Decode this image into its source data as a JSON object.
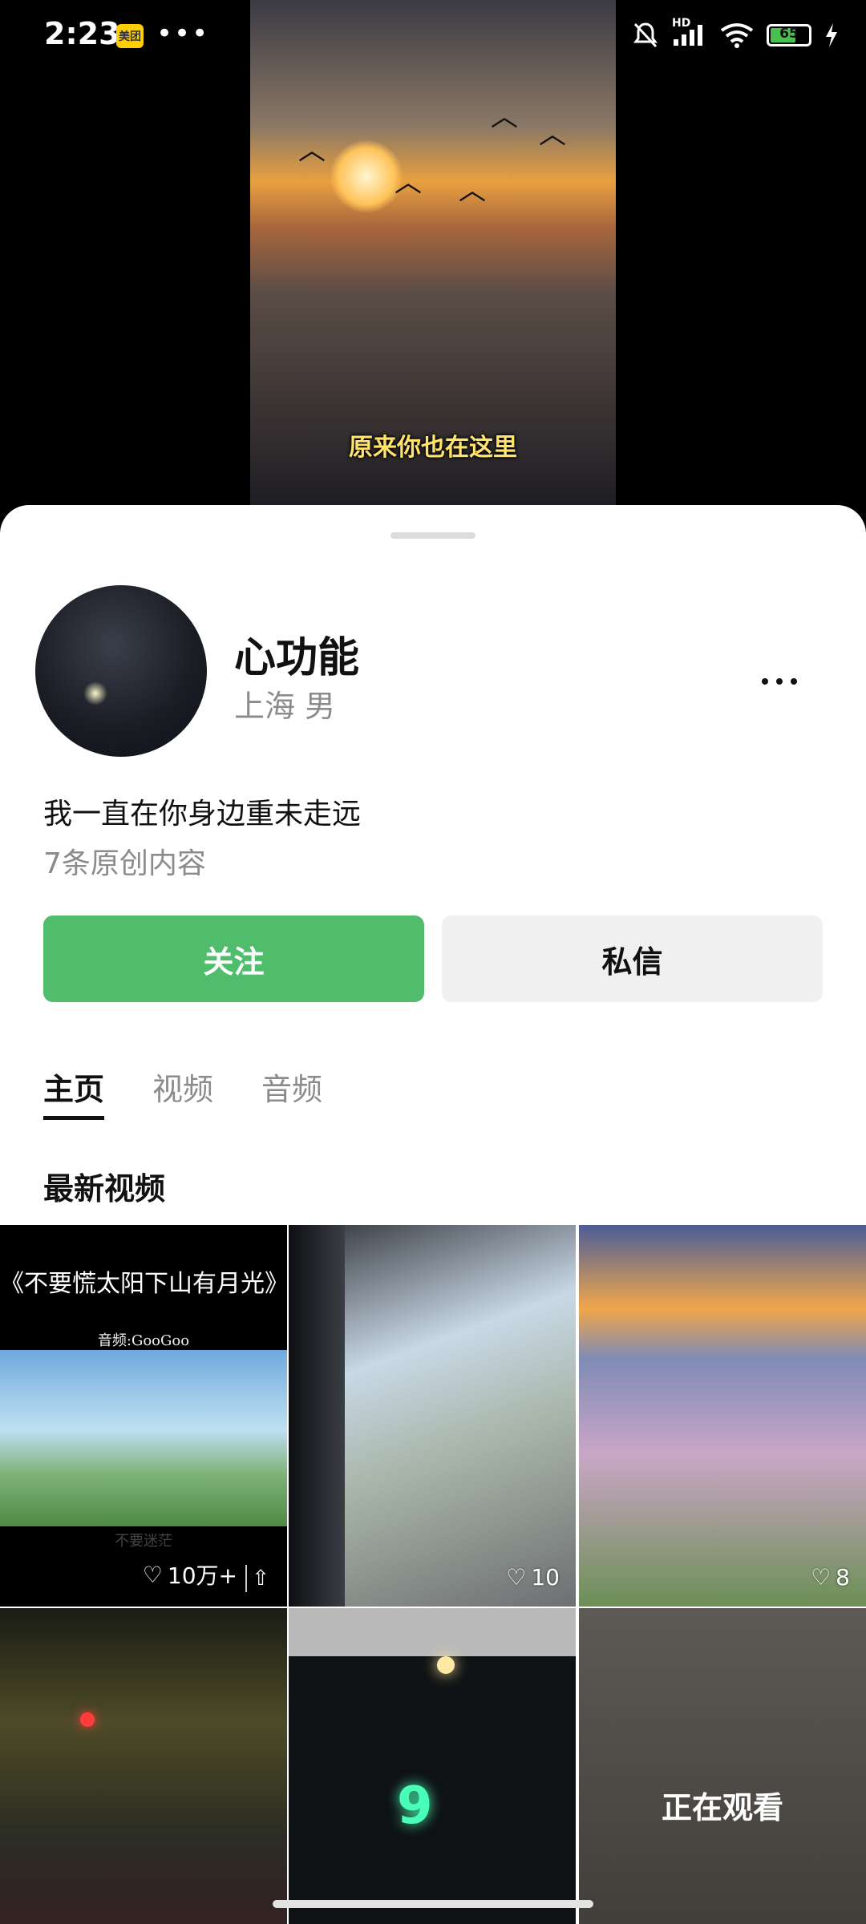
{
  "status_bar": {
    "time": "2:23",
    "meituan_badge": "美团",
    "overflow": "•••",
    "network": "HD",
    "battery": "65"
  },
  "video": {
    "subtitle": "原来你也在这里"
  },
  "profile": {
    "name": "心功能",
    "location_gender": "上海 男",
    "bio": "我一直在你身边重未走远",
    "original_count": "7条原创内容",
    "follow_label": "关注",
    "message_label": "私信"
  },
  "tabs": [
    {
      "label": "主页",
      "active": true
    },
    {
      "label": "视频",
      "active": false
    },
    {
      "label": "音频",
      "active": false
    }
  ],
  "section_title": "最新视频",
  "videos": [
    {
      "title": "《不要慌太阳下山有月光》",
      "audio": "音频:GooGoo",
      "caption": "不要迷茫",
      "likes": "10万+"
    },
    {
      "likes": "10"
    },
    {
      "likes": "8"
    },
    {},
    {},
    {
      "overlay": "正在观看"
    }
  ],
  "icons": {
    "heart": "heart-icon",
    "pin": "pin-top-icon",
    "more": "more-icon"
  },
  "colors": {
    "follow_green": "#4fbd6b",
    "message_gray": "#f0f0f0"
  }
}
